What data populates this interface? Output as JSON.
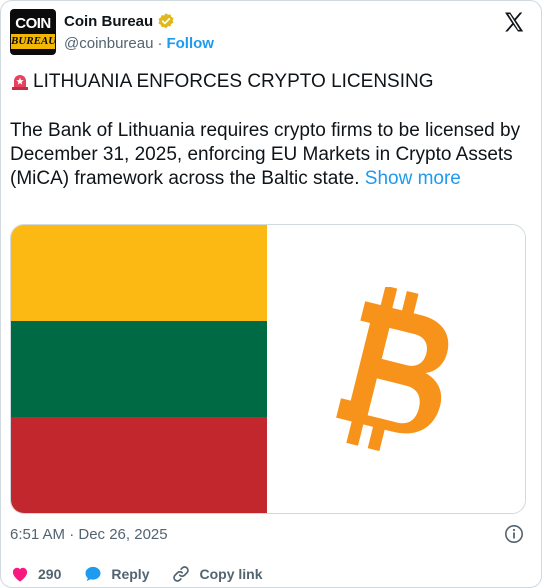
{
  "account": {
    "avatar_line1": "COIN",
    "avatar_line2": "BUREAU",
    "display_name": "Coin Bureau",
    "handle": "@coinbureau",
    "separator": "·",
    "follow_label": "Follow",
    "verified_icon": "verified-badge-gold"
  },
  "post": {
    "headline": "LITHUANIA ENFORCES CRYPTO LICENSING",
    "headline_icon": "rotating-light-siren",
    "body": "The Bank of Lithuania requires crypto firms to be licensed by December 31, 2025, enforcing EU Markets in Crypto Assets (MiCA) framework across the Baltic state.",
    "show_more_label": "Show more",
    "timestamp": "6:51 AM · Dec 26, 2025"
  },
  "media": {
    "flag_colors": [
      "#fdb913",
      "#006a44",
      "#c1272d"
    ],
    "bitcoin_color": "#f7931a",
    "icon": "bitcoin-logo"
  },
  "actions": {
    "like_count": "290",
    "reply_label": "Reply",
    "copy_link_label": "Copy link"
  },
  "colors": {
    "accent": "#1d9bf0",
    "heart": "#f91880",
    "muted": "#536471"
  }
}
